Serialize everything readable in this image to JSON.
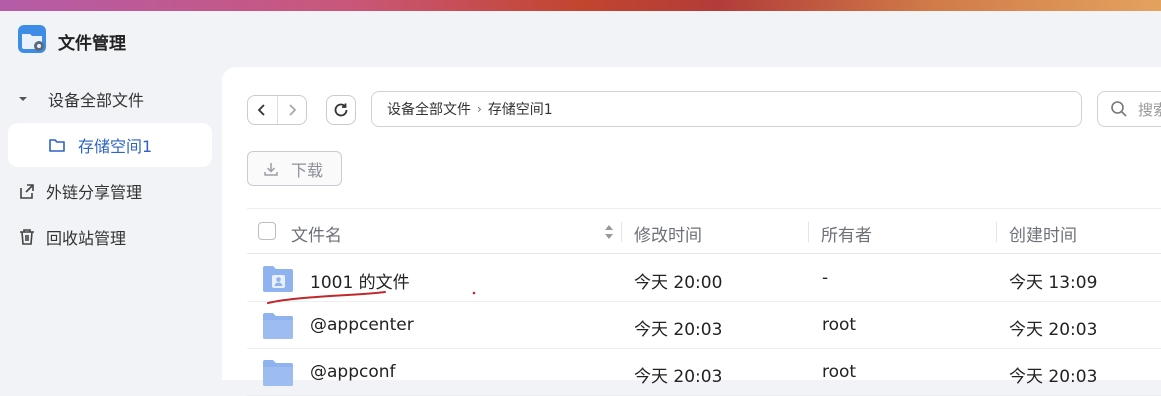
{
  "app": {
    "title": "文件管理"
  },
  "sidebar": {
    "items": [
      {
        "label": "设备全部文件",
        "icon": "caret-down-icon"
      },
      {
        "label": "存储空间1",
        "icon": "folder-icon",
        "active": true
      },
      {
        "label": "外链分享管理",
        "icon": "share-link-icon"
      },
      {
        "label": "回收站管理",
        "icon": "trash-icon"
      }
    ]
  },
  "toolbar": {
    "path": [
      "设备全部文件",
      "存储空间1"
    ],
    "path_separator": "›",
    "search_placeholder": "搜索",
    "download_label": "下载"
  },
  "table": {
    "columns": [
      "文件名",
      "修改时间",
      "所有者",
      "创建时间"
    ],
    "rows": [
      {
        "name": "1001 的文件",
        "modified": "今天 20:00",
        "owner": "-",
        "created": "今天 13:09",
        "icon": "user-folder-icon"
      },
      {
        "name": "@appcenter",
        "modified": "今天 20:03",
        "owner": "root",
        "created": "今天 20:03",
        "icon": "folder-icon"
      },
      {
        "name": "@appconf",
        "modified": "今天 20:03",
        "owner": "root",
        "created": "今天 20:03",
        "icon": "folder-icon"
      }
    ]
  },
  "colors": {
    "accent": "#2f63c6",
    "folder": "#8fb3ee",
    "annotation": "#c0282d"
  }
}
